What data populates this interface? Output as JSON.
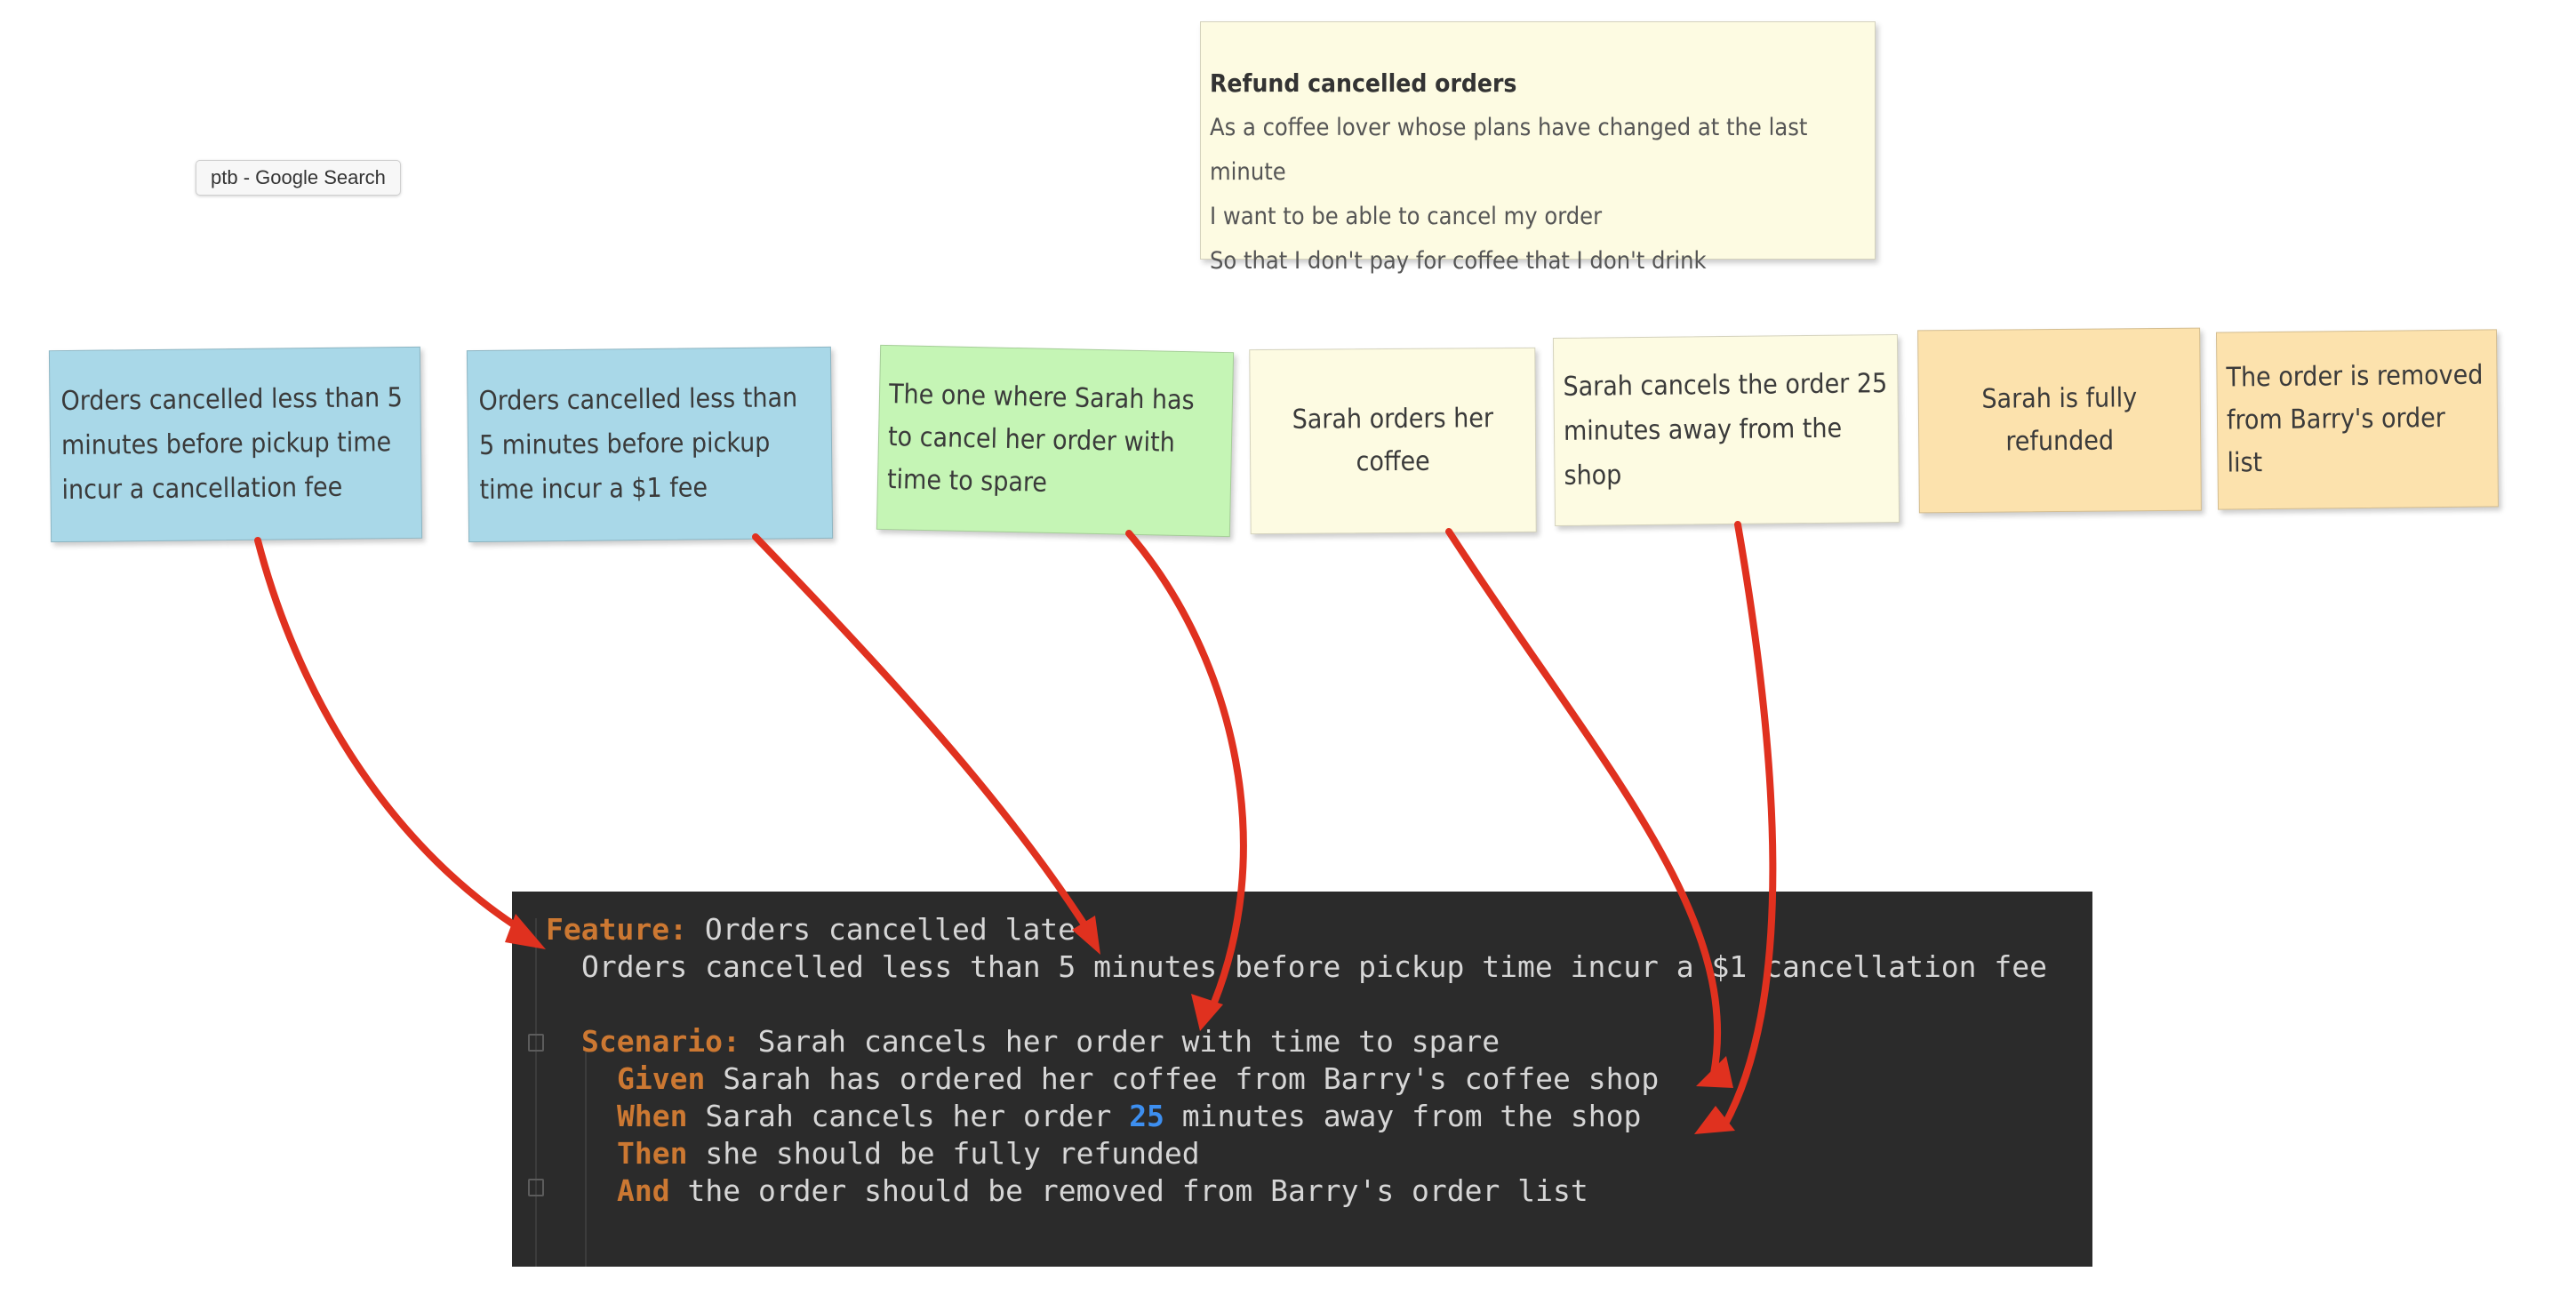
{
  "tooltip": "ptb - Google Search",
  "story": {
    "title": "Refund cancelled orders",
    "lines": [
      "As a coffee lover whose plans have changed at the last minute",
      "I want to be able to cancel my order",
      "So that I don't pay for coffee that I don't drink"
    ]
  },
  "notes": [
    {
      "text": "Orders cancelled less than 5 minutes before pickup time incur a cancellation fee",
      "color": "blue"
    },
    {
      "text": "Orders cancelled less than 5 minutes before pickup time incur a $1 fee",
      "color": "blue"
    },
    {
      "text": "The one where Sarah has to cancel her order with time to spare",
      "color": "green"
    },
    {
      "text": "Sarah orders her coffee",
      "color": "yellow"
    },
    {
      "text": "Sarah cancels the order 25 minutes away from the shop",
      "color": "yellow"
    },
    {
      "text": "Sarah is fully refunded",
      "color": "orange"
    },
    {
      "text": "The order is removed from Barry's order list",
      "color": "orange"
    }
  ],
  "code": {
    "feature_kw": "Feature:",
    "feature_title": " Orders cancelled late",
    "description": "Orders cancelled less than 5 minutes before pickup time incur a $1 cancellation fee",
    "scenario_kw": "Scenario:",
    "scenario_title": " Sarah cancels her order with time to spare",
    "given_kw": "Given",
    "given_text": " Sarah has ordered her coffee from Barry's coffee shop",
    "when_kw": "When",
    "when_text_a": " Sarah cancels her order ",
    "when_number": "25",
    "when_text_b": " minutes away from the shop",
    "then_kw": "Then",
    "then_text": " she should be fully refunded",
    "and_kw": "And",
    "and_text": " the order should be removed from Barry's order list"
  },
  "colors": {
    "arrow": "#e0311f",
    "keyword": "#cc7832",
    "number": "#3d8ff0",
    "editor_bg": "#2b2b2b",
    "note_blue": "#a9d8e8",
    "note_green": "#c5f5b5",
    "note_yellow": "#fdfbe2",
    "note_orange": "#fce2ad"
  }
}
